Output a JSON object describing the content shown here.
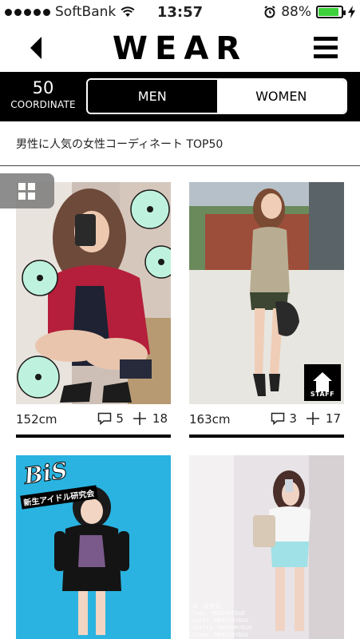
{
  "status": {
    "carrier": "SoftBank",
    "time": "13:57",
    "battery": "88%",
    "battery_level": 0.88,
    "battery_color": "#3cd23c"
  },
  "nav": {
    "title": "WEAR"
  },
  "coordinate": {
    "count": "50",
    "label": "COORDINATE"
  },
  "segments": {
    "men": "MEN",
    "women": "WOMEN",
    "selected": "WOMEN"
  },
  "heading": "男性に人気の女性コーディネート TOP50",
  "cards": [
    {
      "height": "152cm",
      "comments": "5",
      "likes": "18"
    },
    {
      "height": "163cm",
      "comments": "3",
      "likes": "17",
      "badge": "STAFF"
    },
    {
      "logo": "BiS",
      "logo_sub": "新生アイドル研究会"
    },
    {
      "credits": [
        "司　絵里花",
        "Tops　MERCURYDUO",
        "Outer　MERCURYDUO",
        "Skirts　MERCURYDUO",
        "Shoes　MERCURYDUO"
      ]
    }
  ]
}
